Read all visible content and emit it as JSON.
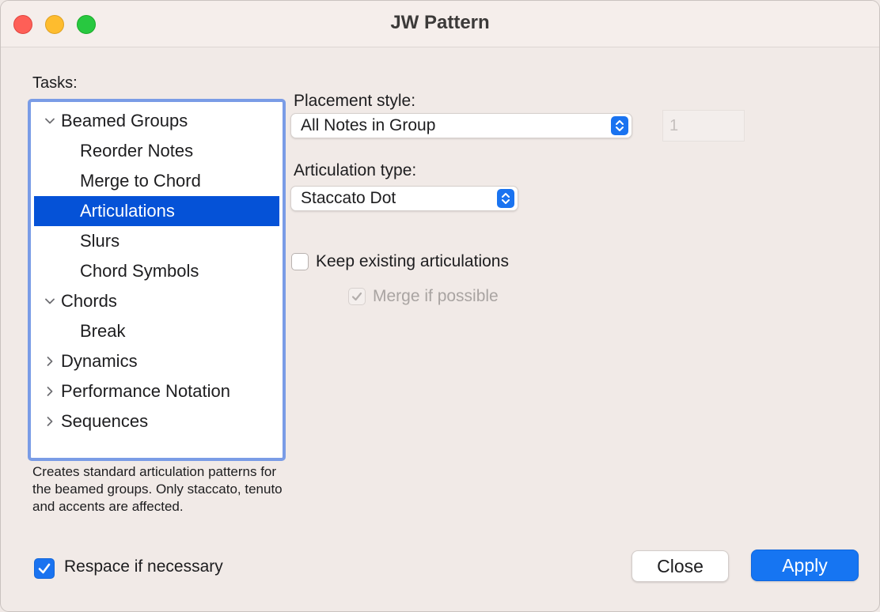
{
  "window": {
    "title": "JW Pattern"
  },
  "tasks": {
    "label": "Tasks:",
    "items": [
      {
        "label": "Beamed Groups",
        "level": 0,
        "expander": "expanded"
      },
      {
        "label": "Reorder Notes",
        "level": 1,
        "expander": "none"
      },
      {
        "label": "Merge to Chord",
        "level": 1,
        "expander": "none"
      },
      {
        "label": "Articulations",
        "level": 1,
        "expander": "none",
        "selected": true
      },
      {
        "label": "Slurs",
        "level": 1,
        "expander": "none"
      },
      {
        "label": "Chord Symbols",
        "level": 1,
        "expander": "none"
      },
      {
        "label": "Chords",
        "level": 0,
        "expander": "expanded"
      },
      {
        "label": "Break",
        "level": 1,
        "expander": "none"
      },
      {
        "label": "Dynamics",
        "level": 0,
        "expander": "collapsed"
      },
      {
        "label": "Performance Notation",
        "level": 0,
        "expander": "collapsed"
      },
      {
        "label": "Sequences",
        "level": 0,
        "expander": "collapsed"
      }
    ],
    "description": "Creates standard articulation patterns for the beamed groups. Only staccato, tenuto and accents are affected."
  },
  "placement": {
    "label": "Placement style:",
    "value": "All Notes in Group",
    "number_value": "1"
  },
  "articulation": {
    "label": "Articulation type:",
    "value": "Staccato Dot"
  },
  "keep_existing": {
    "label": "Keep existing articulations",
    "checked": false
  },
  "merge": {
    "label": "Merge if possible",
    "checked": true,
    "enabled": false
  },
  "respace": {
    "label": "Respace if necessary",
    "checked": true
  },
  "buttons": {
    "close": "Close",
    "apply": "Apply"
  },
  "colors": {
    "accent": "#1a73f0",
    "selection": "#0552d7",
    "focus_ring": "#7a9ce6"
  }
}
